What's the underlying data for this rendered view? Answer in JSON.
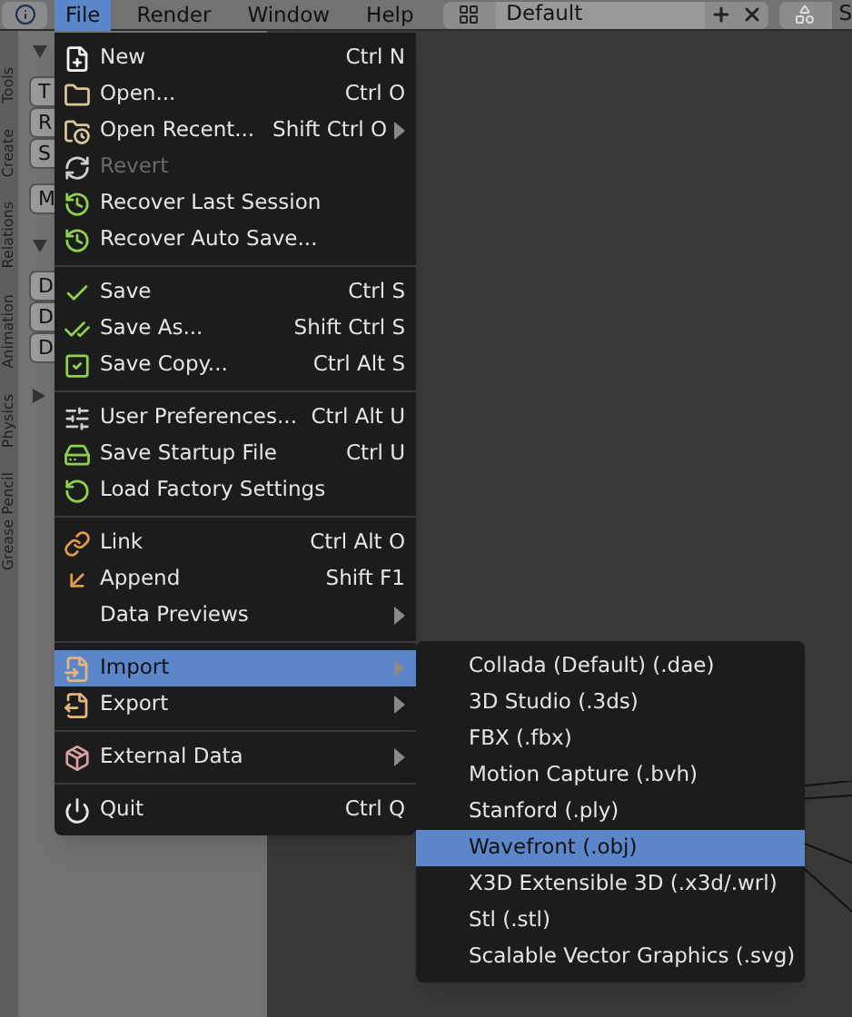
{
  "header": {
    "menus": [
      {
        "label": "File",
        "selected": true
      },
      {
        "label": "Render",
        "selected": false
      },
      {
        "label": "Window",
        "selected": false
      },
      {
        "label": "Help",
        "selected": false
      }
    ],
    "screen_layout": "Default",
    "scene_label": "S"
  },
  "toolshelf": {
    "tabs": [
      "Tools",
      "Create",
      "Relations",
      "Animation",
      "Physics",
      "Grease Pencil"
    ],
    "panels": [
      {
        "expanded": true,
        "buttons": [
          "T",
          "R",
          "S",
          "M"
        ]
      },
      {
        "expanded": true,
        "buttons": [
          "D",
          "D",
          "D"
        ]
      },
      {
        "expanded": false
      }
    ]
  },
  "file_menu": {
    "groups": [
      {
        "items": [
          {
            "label": "New",
            "shortcut": "Ctrl N",
            "kind": "command",
            "disabled": false,
            "selected": false
          },
          {
            "label": "Open...",
            "shortcut": "Ctrl O",
            "kind": "command",
            "disabled": false,
            "selected": false
          },
          {
            "label": "Open Recent...",
            "shortcut": "Shift Ctrl O",
            "kind": "submenu",
            "disabled": false,
            "selected": false
          },
          {
            "label": "Revert",
            "kind": "command",
            "disabled": true,
            "selected": false
          },
          {
            "label": "Recover Last Session",
            "kind": "command",
            "disabled": false,
            "selected": false
          },
          {
            "label": "Recover Auto Save...",
            "kind": "command",
            "disabled": false,
            "selected": false
          }
        ]
      },
      {
        "items": [
          {
            "label": "Save",
            "shortcut": "Ctrl S",
            "kind": "command",
            "disabled": false,
            "selected": false
          },
          {
            "label": "Save As...",
            "shortcut": "Shift Ctrl S",
            "kind": "command",
            "disabled": false,
            "selected": false
          },
          {
            "label": "Save Copy...",
            "shortcut": "Ctrl Alt S",
            "kind": "command",
            "disabled": false,
            "selected": false
          }
        ]
      },
      {
        "items": [
          {
            "label": "User Preferences...",
            "shortcut": "Ctrl Alt U",
            "kind": "command",
            "disabled": false,
            "selected": false
          },
          {
            "label": "Save Startup File",
            "shortcut": "Ctrl U",
            "kind": "command",
            "disabled": false,
            "selected": false
          },
          {
            "label": "Load Factory Settings",
            "kind": "command",
            "disabled": false,
            "selected": false
          }
        ]
      },
      {
        "items": [
          {
            "label": "Link",
            "shortcut": "Ctrl Alt O",
            "kind": "command",
            "disabled": false,
            "selected": false
          },
          {
            "label": "Append",
            "shortcut": "Shift F1",
            "kind": "command",
            "disabled": false,
            "selected": false
          },
          {
            "label": "Data Previews",
            "kind": "submenu",
            "disabled": false,
            "selected": false
          }
        ]
      },
      {
        "items": [
          {
            "label": "Import",
            "kind": "submenu",
            "disabled": false,
            "selected": true
          },
          {
            "label": "Export",
            "kind": "submenu",
            "disabled": false,
            "selected": false
          }
        ]
      },
      {
        "items": [
          {
            "label": "External Data",
            "kind": "submenu",
            "disabled": false,
            "selected": false
          }
        ]
      },
      {
        "items": [
          {
            "label": "Quit",
            "shortcut": "Ctrl Q",
            "kind": "command",
            "disabled": false,
            "selected": false
          }
        ]
      }
    ]
  },
  "import_submenu": {
    "items": [
      {
        "label": "Collada (Default) (.dae)",
        "selected": false
      },
      {
        "label": "3D Studio (.3ds)",
        "selected": false
      },
      {
        "label": "FBX (.fbx)",
        "selected": false
      },
      {
        "label": "Motion Capture (.bvh)",
        "selected": false
      },
      {
        "label": "Stanford (.ply)",
        "selected": false
      },
      {
        "label": "Wavefront (.obj)",
        "selected": true
      },
      {
        "label": "X3D Extensible 3D (.x3d/.wrl)",
        "selected": false
      },
      {
        "label": "Stl (.stl)",
        "selected": false
      },
      {
        "label": "Scalable Vector Graphics (.svg)",
        "selected": false
      }
    ]
  }
}
